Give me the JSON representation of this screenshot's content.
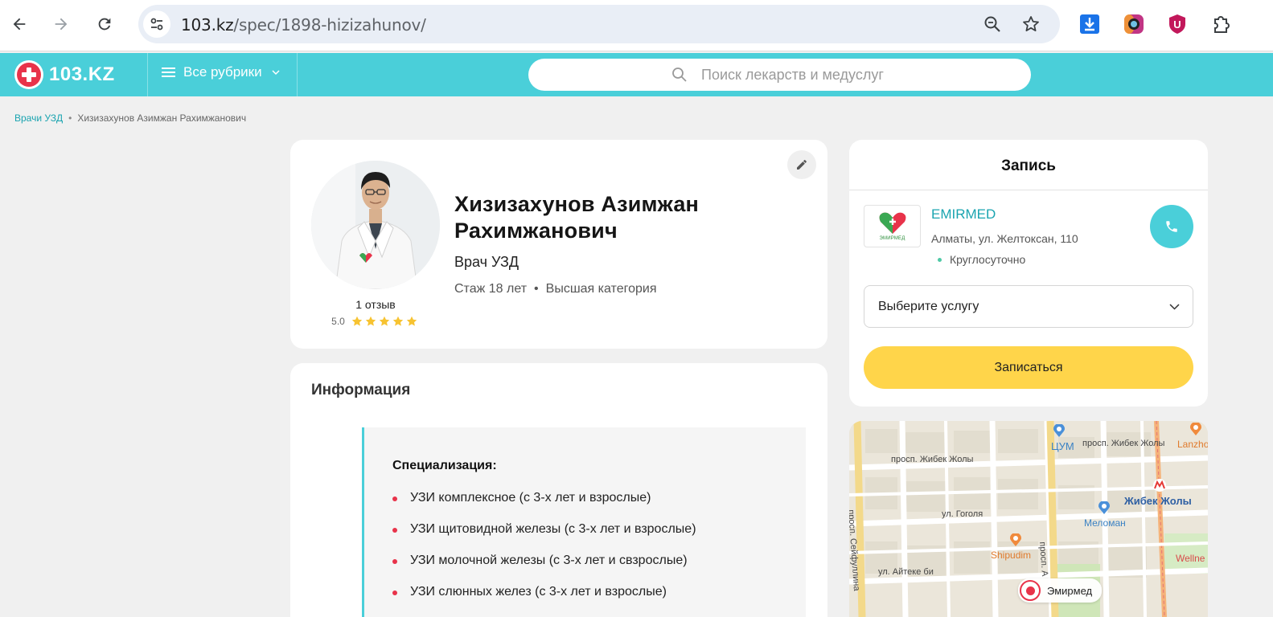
{
  "browser": {
    "url_host": "103.kz",
    "url_path": "/spec/1898-hizizahunov/",
    "icons": [
      "back-icon",
      "forward-icon",
      "reload-icon",
      "site-info-icon",
      "zoom-icon",
      "bookmark-star-icon",
      "download-icon",
      "extension-icon",
      "shield-u-icon",
      "puzzle-icon"
    ]
  },
  "header": {
    "logo_text": "103.KZ",
    "rubrics_label": "Все рубрики",
    "search_placeholder": "Поиск лекарств и медуслуг",
    "accent_color": "#4acfd9"
  },
  "breadcrumb": {
    "items": [
      {
        "label": "Врачи УЗД"
      },
      {
        "label": "Хизизахунов Азимжан Рахимжанович"
      }
    ],
    "separator": "•"
  },
  "doctor": {
    "name_line1": "Хизизахунов Азимжан",
    "name_line2": "Рахимжанович",
    "specialty": "Врач УЗД",
    "experience": "Стаж 18 лет",
    "meta_separator": "•",
    "category": "Высшая категория",
    "reviews": "1 отзыв",
    "rating": "5.0",
    "stars": 5
  },
  "info": {
    "title": "Информация",
    "spec_title": "Специализация:",
    "items": [
      "УЗИ комплексное (с 3-х лет и взрослые)",
      "УЗИ щитовидной железы (с 3-х лет и взрослые)",
      "УЗИ молочной железы (с 3-х лет и свзрослые)",
      "УЗИ слюнных желез (с 3-х лет и взрослые)"
    ]
  },
  "booking": {
    "title": "Запись",
    "clinic_name": "EMIRMED",
    "clinic_logo_text": "ЭМИРМЕД",
    "clinic_address": "Алматы, ул. Желтоксан, 110",
    "clinic_hours": "Круглосуточно",
    "service_placeholder": "Выберите услугу",
    "book_button": "Записаться",
    "button_color": "#ffd54a"
  },
  "map": {
    "street_labels": [
      "просп. Жибек Жолы",
      "просп. Жибек Жолы",
      "просп. Сейфуллина",
      "ул. Гоголя",
      "ул. Айтеке би",
      "просп. А"
    ],
    "pois": [
      "ЦУМ",
      "Жибек Жолы",
      "Меломан",
      "Shipudim",
      "Lanzho",
      "Wellne"
    ],
    "marker_label": "Эмирмед"
  }
}
